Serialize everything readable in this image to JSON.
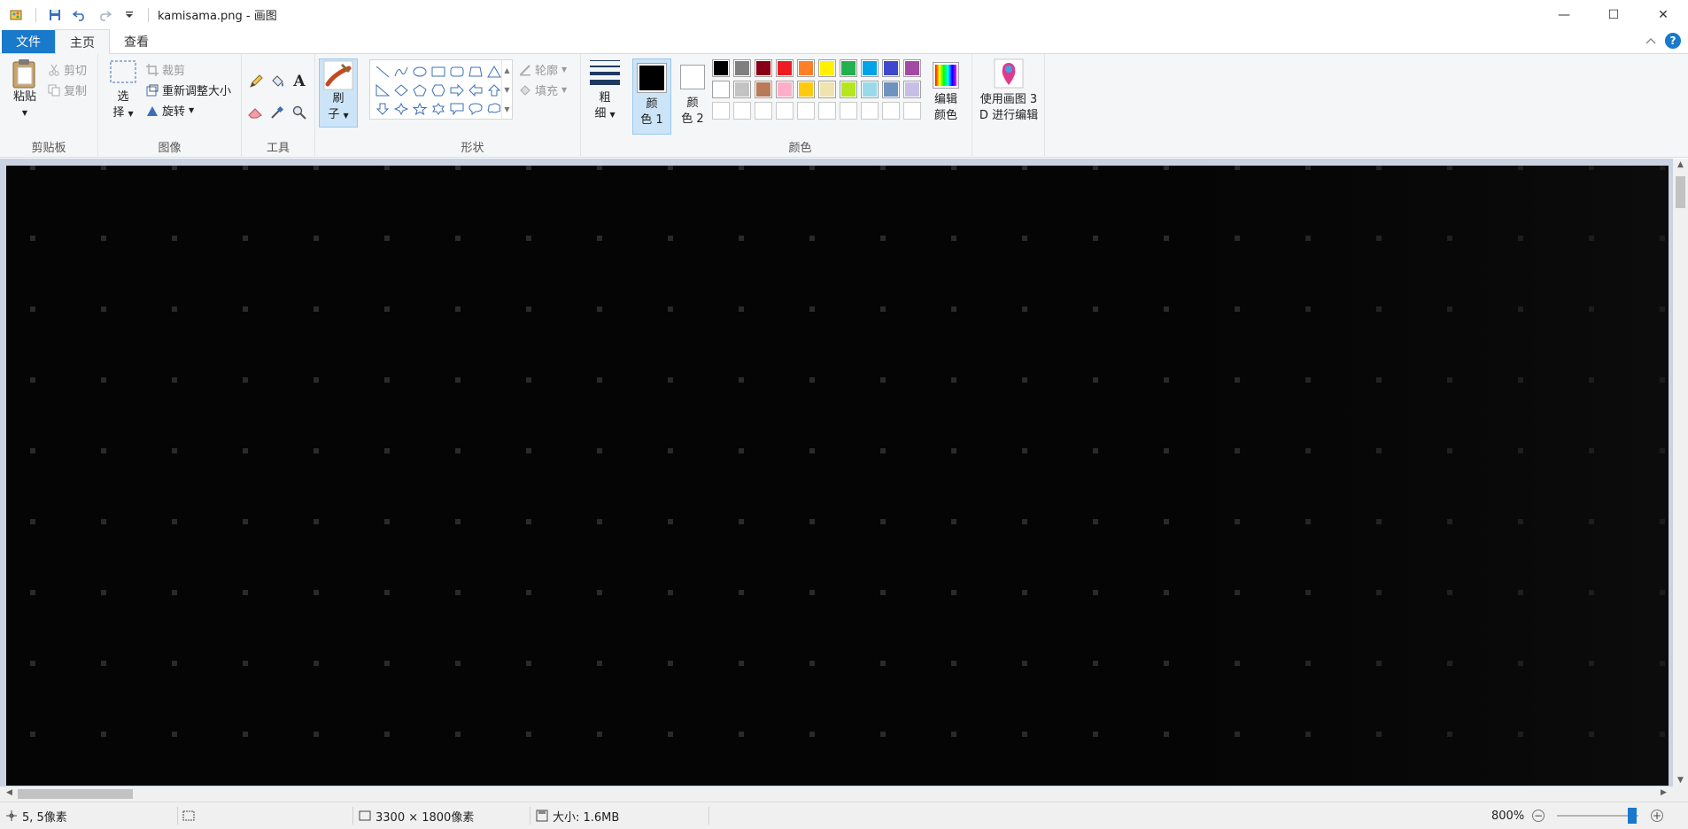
{
  "titlebar": {
    "title": "kamisama.png - 画图",
    "minimize": "—",
    "maximize": "☐",
    "close": "✕"
  },
  "tabs": {
    "file": "文件",
    "home": "主页",
    "view": "查看"
  },
  "clipboard": {
    "paste": "粘贴",
    "cut": "剪切",
    "copy": "复制",
    "label": "剪贴板"
  },
  "image": {
    "select_1": "选",
    "select_2": "择",
    "crop": "裁剪",
    "resize": "重新调整大小",
    "rotate": "旋转",
    "label": "图像"
  },
  "tools": {
    "label": "工具"
  },
  "brushes": {
    "label_1": "刷",
    "label_2": "子"
  },
  "shapes": {
    "outline": "轮廓",
    "fill": "填充",
    "label": "形状"
  },
  "size": {
    "label_1": "粗",
    "label_2": "细"
  },
  "colors": {
    "color1_1": "颜",
    "color1_2": "色 1",
    "color2_1": "颜",
    "color2_2": "色 2",
    "edit_1": "编辑",
    "edit_2": "颜色",
    "label": "颜色",
    "color1": "#000000",
    "color2": "#ffffff",
    "palette_row1": [
      "#000000",
      "#7f7f7f",
      "#880015",
      "#ed1c24",
      "#ff7f27",
      "#fff200",
      "#22b14c",
      "#00a2e8",
      "#3f48cc",
      "#a349a4"
    ],
    "palette_row2": [
      "#ffffff",
      "#c3c3c3",
      "#b97a57",
      "#ffaec9",
      "#ffc90e",
      "#efe4b0",
      "#b5e61d",
      "#99d9ea",
      "#7092be",
      "#c8bfe7"
    ]
  },
  "paint3d": {
    "label_1": "使用画图 3",
    "label_2": "D 进行编辑"
  },
  "status": {
    "cursor": "5, 5像素",
    "dimensions": "3300 × 1800像素",
    "filesize": "大小: 1.6MB",
    "zoom": "800%"
  }
}
